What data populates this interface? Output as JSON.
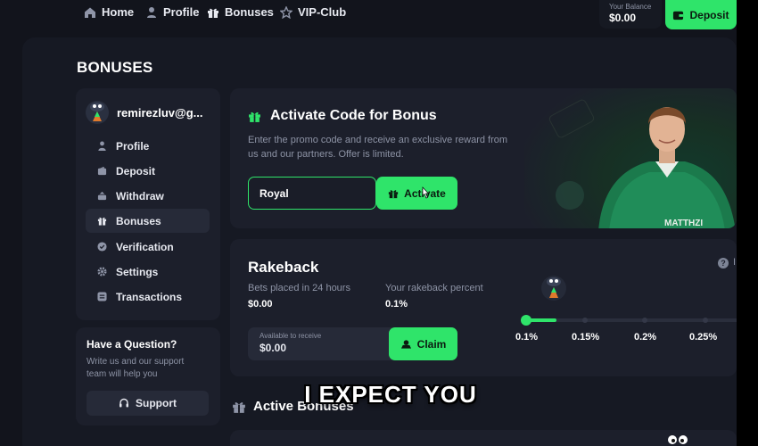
{
  "nav": {
    "items": [
      {
        "label": "Home",
        "icon": "home-icon"
      },
      {
        "label": "Profile",
        "icon": "person-icon"
      },
      {
        "label": "Bonuses",
        "icon": "gift-icon"
      },
      {
        "label": "VIP-Club",
        "icon": "star-icon"
      }
    ],
    "balance_label": "Your Balance",
    "balance_value": "$0.00",
    "deposit_label": "Deposit"
  },
  "page_title": "BONUSES",
  "sidebar": {
    "user_name": "remirezluv@g...",
    "items": [
      {
        "label": "Profile",
        "icon": "person-icon"
      },
      {
        "label": "Deposit",
        "icon": "wallet-icon"
      },
      {
        "label": "Withdraw",
        "icon": "withdraw-icon"
      },
      {
        "label": "Bonuses",
        "icon": "gift-icon",
        "active": true
      },
      {
        "label": "Verification",
        "icon": "verified-icon"
      },
      {
        "label": "Settings",
        "icon": "gear-icon"
      },
      {
        "label": "Transactions",
        "icon": "transactions-icon"
      }
    ]
  },
  "help": {
    "title": "Have a Question?",
    "text": "Write us and our support team will help you",
    "support_label": "Support"
  },
  "activate_code": {
    "title": "Activate Code for Bonus",
    "description": "Enter the promo code and receive an exclusive reward from us and our partners. Offer is limited.",
    "input_value": "Royal",
    "button_label": "Activate"
  },
  "rakeback": {
    "title": "Rakeback",
    "bets_label": "Bets placed in 24 hours",
    "bets_value": "$0.00",
    "percent_label": "Your rakeback percent",
    "percent_value": "0.1%",
    "available_label": "Available to receive",
    "available_value": "$0.00",
    "claim_label": "Claim",
    "info_cut": "I",
    "levels": [
      "0.1%",
      "0.15%",
      "0.2%",
      "0.25%"
    ],
    "progress_fraction": 0.15
  },
  "active_bonuses": {
    "title": "Active Bonuses"
  },
  "caption": "I EXPECT YOU",
  "colors": {
    "accent": "#2fe46a",
    "background": "#12141c",
    "card": "#1c1f2b",
    "muted_text": "#8d93a5"
  }
}
